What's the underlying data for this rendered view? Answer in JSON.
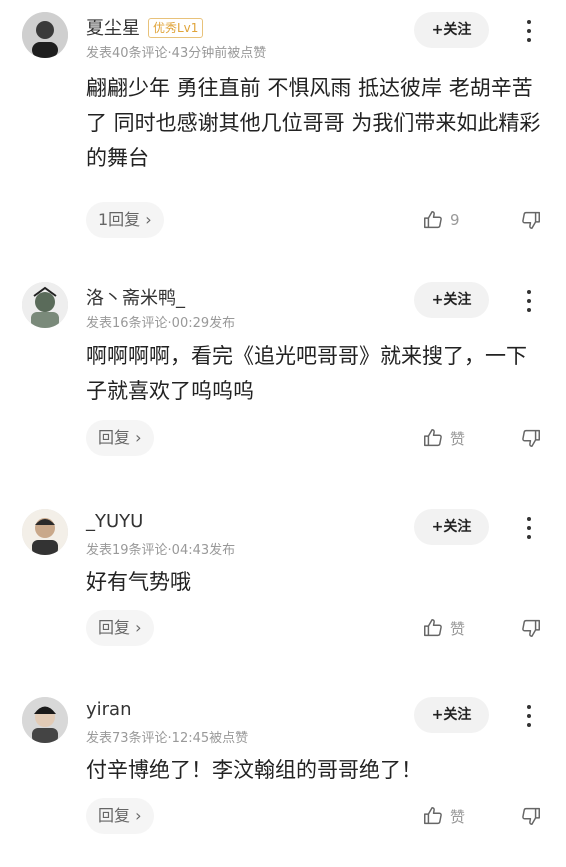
{
  "comments": [
    {
      "username": "夏尘星",
      "badge": "优秀Lv1",
      "meta": "发表40条评论·43分钟前被点赞",
      "follow_label": "+关注",
      "text": "翩翩少年 勇往直前 不惧风雨 抵达彼岸 老胡辛苦了 同时也感谢其他几位哥哥 为我们带来如此精彩的舞台",
      "reply_label": "1回复 ›",
      "like_label": "9"
    },
    {
      "username": "洛丶斋米鸭_",
      "badge": "",
      "meta": "发表16条评论·00:29发布",
      "follow_label": "+关注",
      "text": "啊啊啊啊，看完《追光吧哥哥》就来搜了，一下子就喜欢了呜呜呜",
      "reply_label": "回复 ›",
      "like_label": "赞"
    },
    {
      "username": "_YUYU",
      "badge": "",
      "meta": "发表19条评论·04:43发布",
      "follow_label": "+关注",
      "text": "好有气势哦",
      "reply_label": "回复 ›",
      "like_label": "赞"
    },
    {
      "username": "yiran",
      "badge": "",
      "meta": "发表73条评论·12:45被点赞",
      "follow_label": "+关注",
      "text": "付辛博绝了！李汶翰组的哥哥绝了！",
      "reply_label": "回复 ›",
      "like_label": "赞"
    }
  ],
  "icons": {
    "like": "thumbs-up-icon",
    "dislike": "thumbs-down-icon",
    "more": "more-vertical-icon"
  }
}
